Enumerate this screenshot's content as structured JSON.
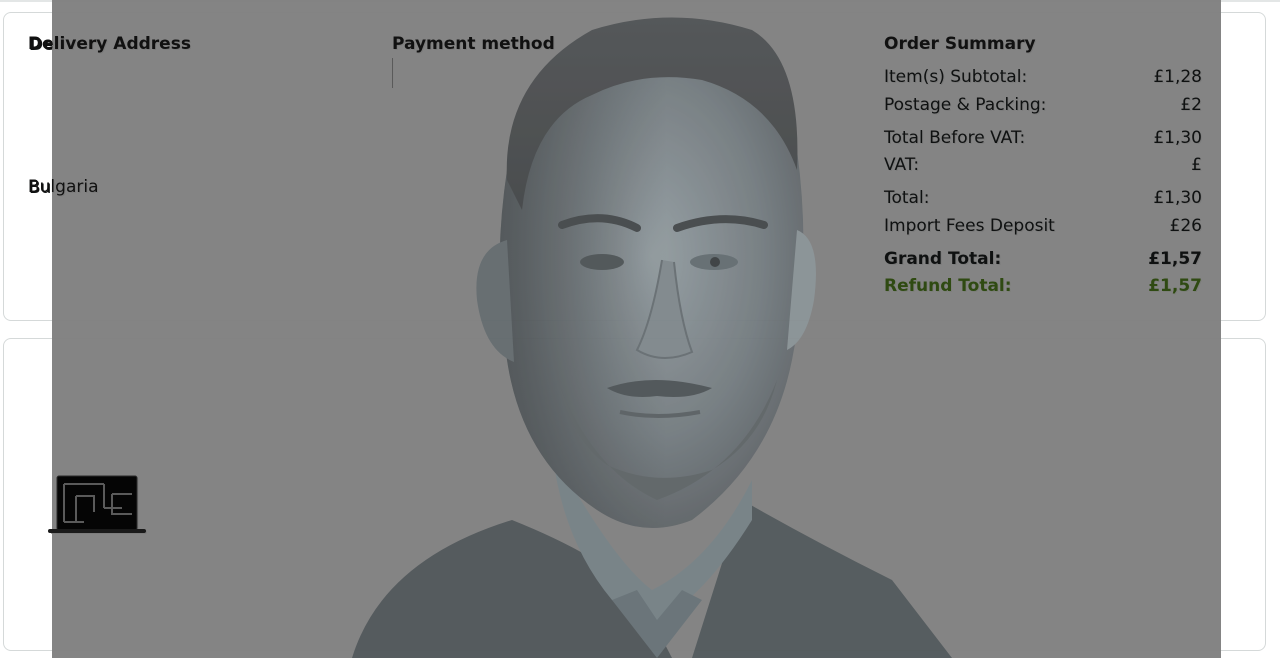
{
  "delivery": {
    "title": "Delivery Address",
    "country": "Bulgaria"
  },
  "payment": {
    "title": "Payment method"
  },
  "order_summary": {
    "title": "Order Summary",
    "rows": [
      {
        "label": "Item(s) Subtotal:",
        "value": "£1,28"
      },
      {
        "label": "Postage & Packing:",
        "value": "£2"
      },
      {
        "label": "Total Before VAT:",
        "value": "£1,30"
      },
      {
        "label": "VAT:",
        "value": "£"
      },
      {
        "label": "Total:",
        "value": "£1,30"
      },
      {
        "label": "Import Fees Deposit",
        "value": "£26"
      },
      {
        "label": "Grand Total:",
        "value": "£1,57"
      },
      {
        "label": "Refund Total:",
        "value": "£1,57"
      }
    ]
  },
  "product": {
    "icon": "laptop-icon"
  },
  "overlay": {
    "image": "portrait-photo",
    "color": "#828282"
  },
  "colors": {
    "refund": "#3b7a18",
    "border": "#d5d9d9"
  }
}
